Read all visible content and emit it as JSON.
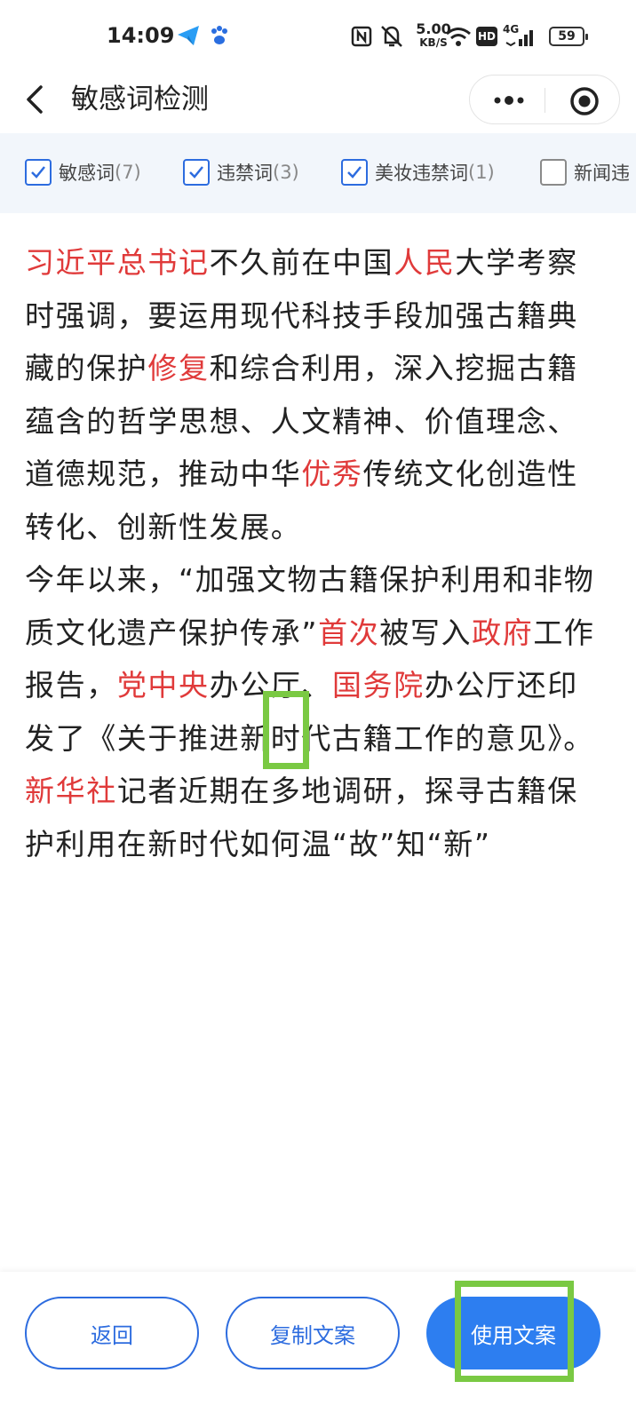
{
  "status_bar": {
    "time": "14:09",
    "net_speed_value": "5.00",
    "net_speed_unit": "KB/S",
    "signal_label": "4G",
    "hd_label": "HD",
    "battery": "59",
    "icons": [
      "telegram-like-app-icon",
      "paw-app-icon",
      "nfc-icon",
      "mute-bell-icon",
      "wifi-icon",
      "hd-icon",
      "signal-icon",
      "battery-icon"
    ]
  },
  "nav": {
    "title": "敏感词检测",
    "icons": [
      "back-arrow-icon",
      "more-dots-icon",
      "target-icon"
    ]
  },
  "filters": [
    {
      "label": "敏感词",
      "count": "(7)",
      "checked": true
    },
    {
      "label": "违禁词",
      "count": "(3)",
      "checked": true
    },
    {
      "label": "美妆违禁词",
      "count": "(1)",
      "checked": true
    },
    {
      "label": "新闻违",
      "count": "",
      "checked": false
    }
  ],
  "article": {
    "p1": [
      {
        "t": "习近平总书记",
        "hl": true
      },
      {
        "t": "不久前在中国",
        "hl": false
      },
      {
        "t": "人民",
        "hl": true
      },
      {
        "t": "大学考察时强调，要运用现代科技手段加强古籍典藏的保护",
        "hl": false
      },
      {
        "t": "修复",
        "hl": true
      },
      {
        "t": "和综合利用，深入挖掘古籍蕴含的哲学思想、人文精神、价值理念、道德规范，推动中华",
        "hl": false
      },
      {
        "t": "优秀",
        "hl": true
      },
      {
        "t": "传统文化创造性转化、创新性发展。",
        "hl": false
      }
    ],
    "p2": [
      {
        "t": "今年以来，“加强文物古籍保护利用和非物质文化遗产保护传承”",
        "hl": false
      },
      {
        "t": "首次",
        "hl": true
      },
      {
        "t": "被写入",
        "hl": false
      },
      {
        "t": "政府",
        "hl": true
      },
      {
        "t": "工作报告，",
        "hl": false
      },
      {
        "t": "党",
        "hl": true
      },
      {
        "t": "中央",
        "hl": true
      },
      {
        "t": "办公厅、",
        "hl": false
      },
      {
        "t": "国务院",
        "hl": true
      },
      {
        "t": "办公厅还印发了《关于推进新时代古籍工作的意见》。",
        "hl": false
      },
      {
        "t": "新华社",
        "hl": true
      },
      {
        "t": "记者近期在多地调研，探寻古籍保护利用在新时代如何温“故”知“新”",
        "hl": false
      }
    ]
  },
  "buttons": {
    "back": "返回",
    "copy": "复制文案",
    "use": "使用文案"
  },
  "colors": {
    "accent": "#2d6cdf",
    "primary_button": "#2d7ef0",
    "highlight_text": "#e03a3a",
    "annotation_box": "#7ac943",
    "filter_bg": "#f2f6fb"
  }
}
